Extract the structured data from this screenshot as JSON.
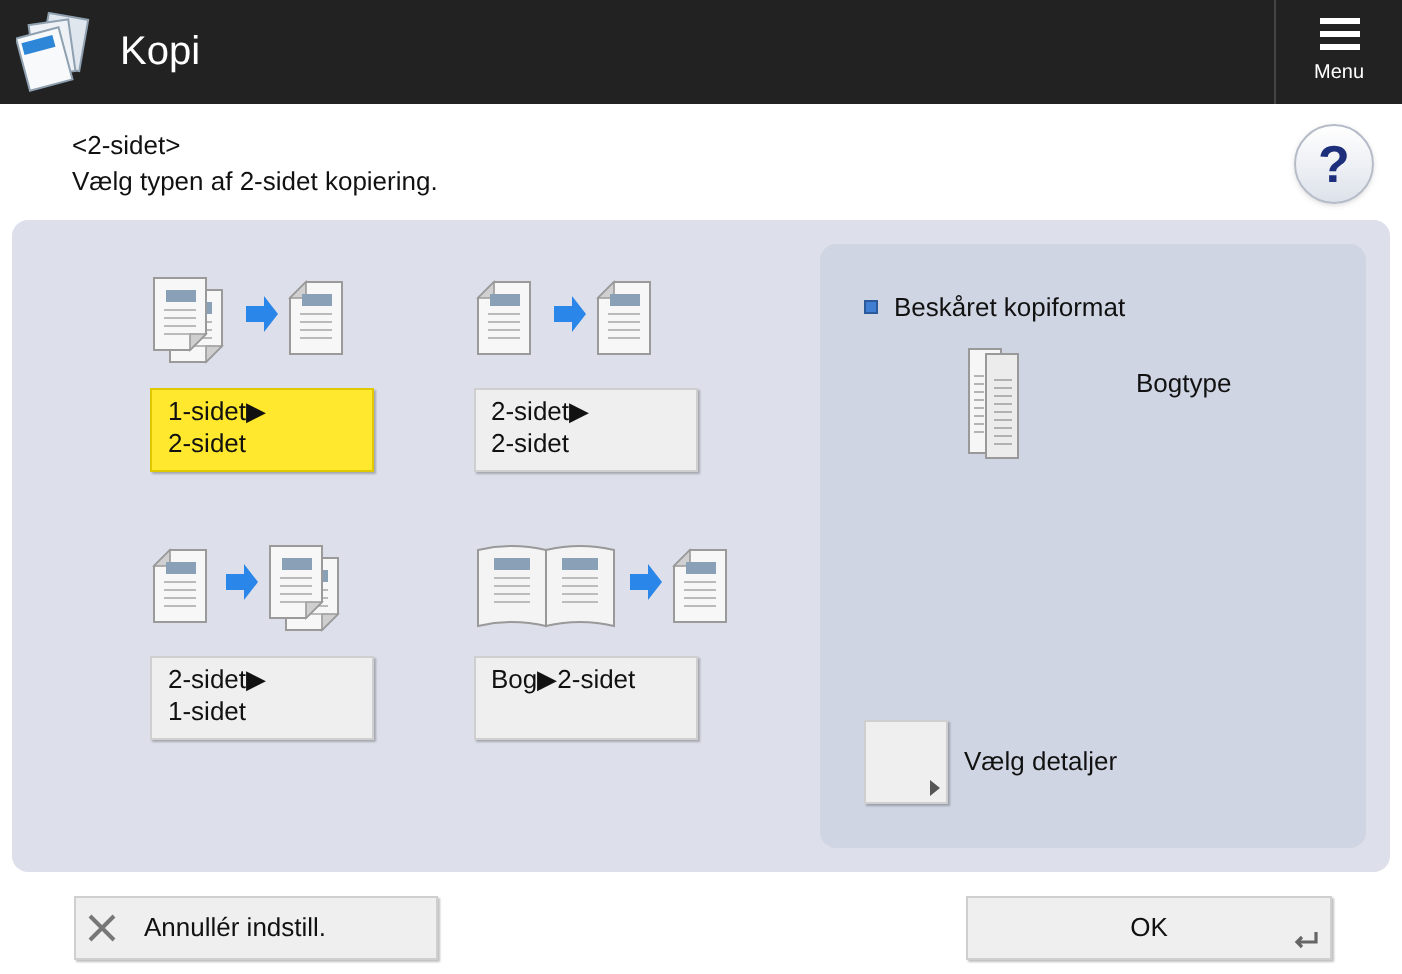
{
  "header": {
    "title": "Kopi",
    "menu_label": "Menu"
  },
  "heading": {
    "title": "<2-sidet>",
    "instruction": "Vælg typen af 2-sidet kopiering.",
    "help_label": "?"
  },
  "options": [
    {
      "kind": "one_to_two",
      "lines": [
        "1-sidet▶",
        "2-sidet"
      ],
      "selected": true
    },
    {
      "kind": "two_to_two",
      "lines": [
        "2-sidet▶",
        "2-sidet"
      ],
      "selected": false
    },
    {
      "kind": "two_to_one",
      "lines": [
        "2-sidet▶",
        "1-sidet"
      ],
      "selected": false
    },
    {
      "kind": "book_to_two",
      "lines": [
        "Bog▶2-sidet"
      ],
      "selected": false
    }
  ],
  "side_panel": {
    "section_label": "Beskåret kopiformat",
    "type_label": "Bogtype",
    "details_label": "Vælg detaljer"
  },
  "footer": {
    "cancel_label": "Annullér indstill.",
    "ok_label": "OK"
  }
}
